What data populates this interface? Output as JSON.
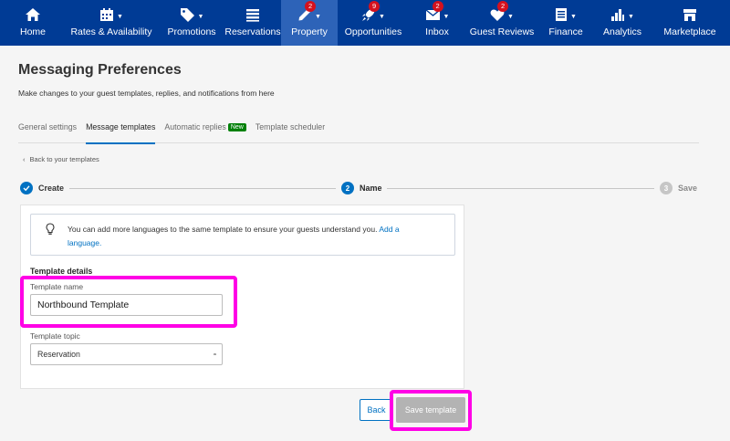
{
  "nav": {
    "items": [
      {
        "label": "Home",
        "icon": "home-icon",
        "badge": "",
        "caret": false,
        "active": false
      },
      {
        "label": "Rates & Availability",
        "icon": "calendar-icon",
        "badge": "",
        "caret": true,
        "active": false
      },
      {
        "label": "Promotions",
        "icon": "tag-icon",
        "badge": "",
        "caret": true,
        "active": false
      },
      {
        "label": "Reservations",
        "icon": "list-icon",
        "badge": "",
        "caret": false,
        "active": false
      },
      {
        "label": "Property",
        "icon": "pencil-icon",
        "badge": "2",
        "caret": true,
        "active": true
      },
      {
        "label": "Opportunities",
        "icon": "rocket-icon",
        "badge": "9",
        "caret": true,
        "active": false
      },
      {
        "label": "Inbox",
        "icon": "envelope-icon",
        "badge": "2",
        "caret": true,
        "active": false
      },
      {
        "label": "Guest Reviews",
        "icon": "heart-icon",
        "badge": "2",
        "caret": true,
        "active": false
      },
      {
        "label": "Finance",
        "icon": "document-icon",
        "badge": "",
        "caret": true,
        "active": false
      },
      {
        "label": "Analytics",
        "icon": "bar-chart-icon",
        "badge": "",
        "caret": true,
        "active": false
      },
      {
        "label": "Marketplace",
        "icon": "store-icon",
        "badge": "",
        "caret": false,
        "active": false
      }
    ]
  },
  "page": {
    "title": "Messaging Preferences",
    "subtitle": "Make changes to your guest templates, replies, and notifications from here"
  },
  "tabs": {
    "general": "General settings",
    "templates": "Message templates",
    "auto_replies": "Automatic replies",
    "new_badge": "New",
    "scheduler": "Template scheduler"
  },
  "back_link": "Back to your templates",
  "stepper": {
    "step1": {
      "number": "1",
      "label": "Create"
    },
    "step2": {
      "number": "2",
      "label": "Name"
    },
    "step3": {
      "number": "3",
      "label": "Save"
    }
  },
  "info": {
    "text": "You can add more languages to the same template to ensure your guests understand you.",
    "link": "Add a language."
  },
  "form": {
    "section_title": "Template details",
    "name_label": "Template name",
    "name_value": "Northbound Template",
    "topic_label": "Template topic",
    "topic_value": "Reservation"
  },
  "actions": {
    "back": "Back",
    "save": "Save template"
  },
  "colors": {
    "nav_bg": "#003b95",
    "accent": "#0071c2",
    "highlight": "#ff00e6",
    "badge": "#d4111e",
    "new_badge": "#008009"
  }
}
